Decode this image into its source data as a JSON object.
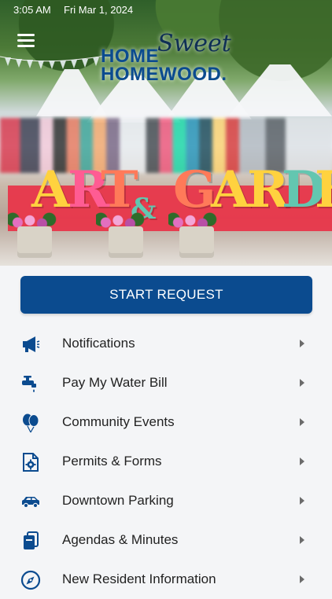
{
  "status_bar": {
    "time": "3:05 AM",
    "date": "Fri Mar 1, 2024"
  },
  "hero": {
    "logo": {
      "home": "HOME",
      "sweet": "Sweet",
      "homewood": "HOMEWOOD."
    },
    "sign_letters": [
      "A",
      "R",
      "T",
      "&",
      "G",
      "A",
      "R",
      "D",
      "E"
    ]
  },
  "actions": {
    "start_request": "START REQUEST"
  },
  "menu": {
    "items": [
      {
        "label": "Notifications",
        "icon": "megaphone-icon"
      },
      {
        "label": "Pay My Water Bill",
        "icon": "faucet-icon"
      },
      {
        "label": "Community Events",
        "icon": "balloons-icon"
      },
      {
        "label": "Permits & Forms",
        "icon": "document-gear-icon"
      },
      {
        "label": "Downtown Parking",
        "icon": "car-icon"
      },
      {
        "label": "Agendas & Minutes",
        "icon": "folder-stack-icon"
      },
      {
        "label": "New Resident Information",
        "icon": "compass-icon"
      }
    ]
  },
  "colors": {
    "brand_blue": "#0b4b8f",
    "background": "#f4f5f7",
    "text": "#222222",
    "chevron": "#6b6b6b"
  }
}
